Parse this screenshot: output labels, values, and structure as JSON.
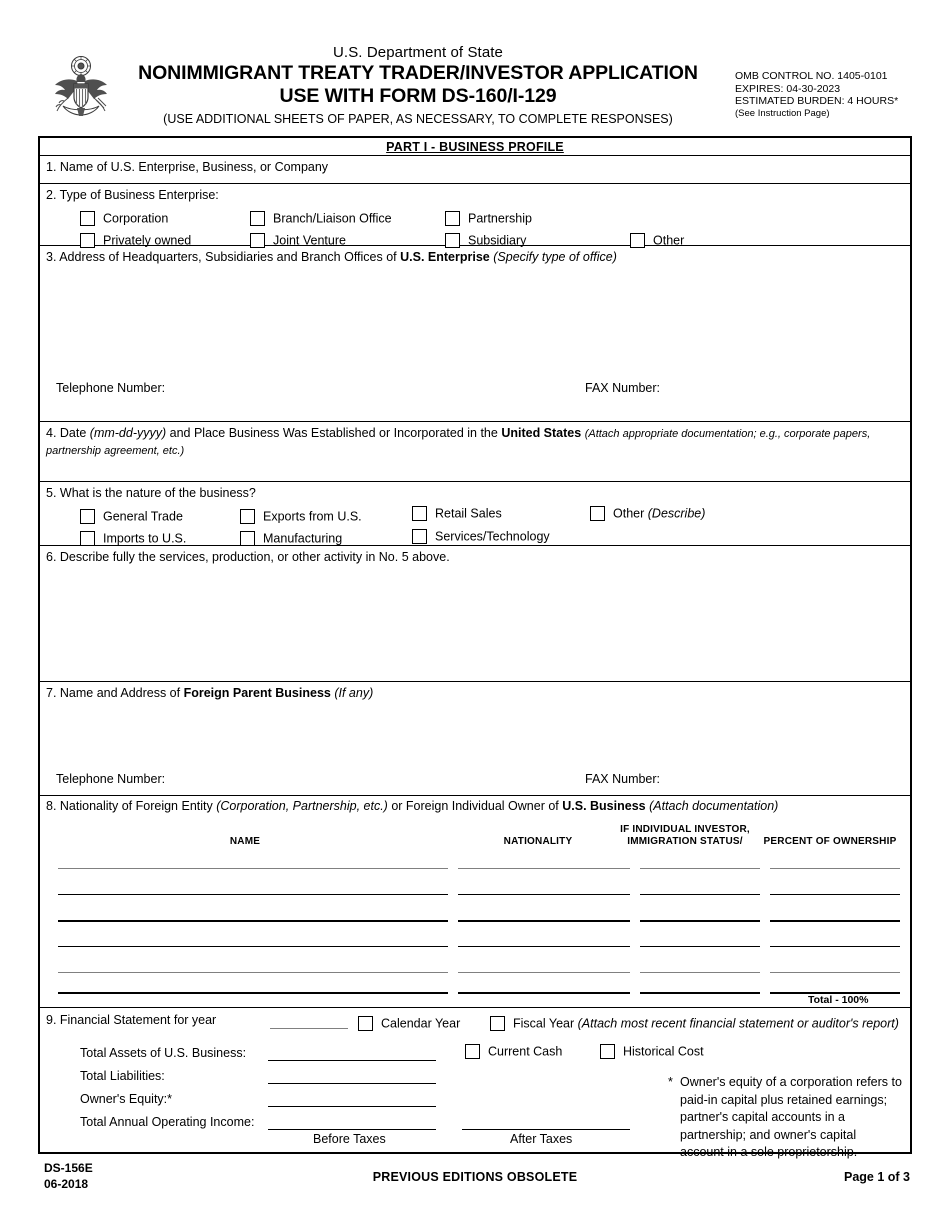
{
  "header": {
    "seal_icon": "us-great-seal-icon",
    "agency": "U.S. Department of State",
    "title_line1": "NONIMMIGRANT TREATY TRADER/INVESTOR APPLICATION",
    "title_line2": "USE WITH FORM DS-160/I-129",
    "subtitle": "(USE ADDITIONAL SHEETS OF PAPER, AS NECESSARY, TO COMPLETE RESPONSES)",
    "omb": {
      "control_no": "OMB CONTROL NO.  1405-0101",
      "expires": "EXPIRES: 04-30-2023",
      "burden": "ESTIMATED BURDEN: 4 HOURS*",
      "instruction": "(See Instruction Page)"
    }
  },
  "part_header": "PART I - BUSINESS PROFILE",
  "q1": {
    "label": "1.  Name of U.S. Enterprise, Business, or Company"
  },
  "q2": {
    "label": "2.  Type of Business Enterprise:",
    "options": [
      {
        "label": "Corporation"
      },
      {
        "label": "Privately owned"
      },
      {
        "label": "Branch/Liaison Office"
      },
      {
        "label": "Joint Venture"
      },
      {
        "label": "Partnership"
      },
      {
        "label": "Subsidiary"
      },
      {
        "label": "Other"
      }
    ]
  },
  "q3": {
    "label_pre": "3.  Address of Headquarters, Subsidiaries and Branch Offices of ",
    "label_bold": "U.S. Enterprise",
    "label_italic": "(Specify type of office)",
    "telephone_label": "Telephone Number:",
    "fax_label": "FAX Number:"
  },
  "q4": {
    "label_pre": "4.  Date ",
    "label_italic1": "(mm-dd-yyyy)",
    "label_mid": " and Place Business Was Established or Incorporated in the ",
    "label_bold": "United States",
    "label_italic2": "(Attach appropriate documentation; e.g., corporate papers, partnership agreement, etc.)"
  },
  "q5": {
    "label": "5.  What is the nature of the business?",
    "options": [
      {
        "label": "General Trade"
      },
      {
        "label": "Imports to U.S."
      },
      {
        "label": "Exports from U.S."
      },
      {
        "label": "Manufacturing"
      },
      {
        "label": "Retail Sales"
      },
      {
        "label": "Services/Technology"
      },
      {
        "label": "Other",
        "suffix": "(Describe)"
      }
    ]
  },
  "q6": {
    "label": "6.  Describe fully the services, production, or other activity in No. 5 above."
  },
  "q7": {
    "label_pre": "7.  Name and Address of ",
    "label_bold": "Foreign Parent Business",
    "label_italic": "(If any)",
    "telephone_label": "Telephone Number:",
    "fax_label": "FAX Number:"
  },
  "q8": {
    "label_pre": "8. Nationality of Foreign Entity ",
    "label_italic1": "(Corporation, Partnership, etc.)",
    "label_mid": " or Foreign Individual Owner of ",
    "label_bold": "U.S. Business",
    "label_italic2": "(Attach documentation)",
    "columns": [
      {
        "header": "NAME"
      },
      {
        "header": "NATIONALITY"
      },
      {
        "header_line1": "IF INDIVIDUAL INVESTOR,",
        "header_line2": "IMMIGRATION STATUS/"
      },
      {
        "header": "PERCENT OF OWNERSHIP"
      }
    ],
    "row_count": 6,
    "total_label": "Total - 100%"
  },
  "q9": {
    "label": "9.  Financial Statement for year",
    "calendar_year": "Calendar Year",
    "fiscal_year": "Fiscal Year",
    "fiscal_note": "(Attach most recent financial statement or auditor's report)",
    "rows": [
      {
        "label": "Total Assets of U.S. Business:"
      },
      {
        "label": "Total Liabilities:"
      },
      {
        "label": "Owner's Equity:*"
      },
      {
        "label": "Total Annual Operating Income:"
      }
    ],
    "current_cash": "Current Cash",
    "historical_cost": "Historical Cost",
    "before_taxes": "Before Taxes",
    "after_taxes": "After Taxes",
    "footnote": "Owner's equity of a corporation refers to paid-in capital plus retained earnings; partner's capital accounts in a partnership; and owner's capital account in a sole proprietorship."
  },
  "footer": {
    "form_no": "DS-156E",
    "form_date": "06-2018",
    "center": "PREVIOUS EDITIONS OBSOLETE",
    "page": "Page 1 of 3"
  }
}
